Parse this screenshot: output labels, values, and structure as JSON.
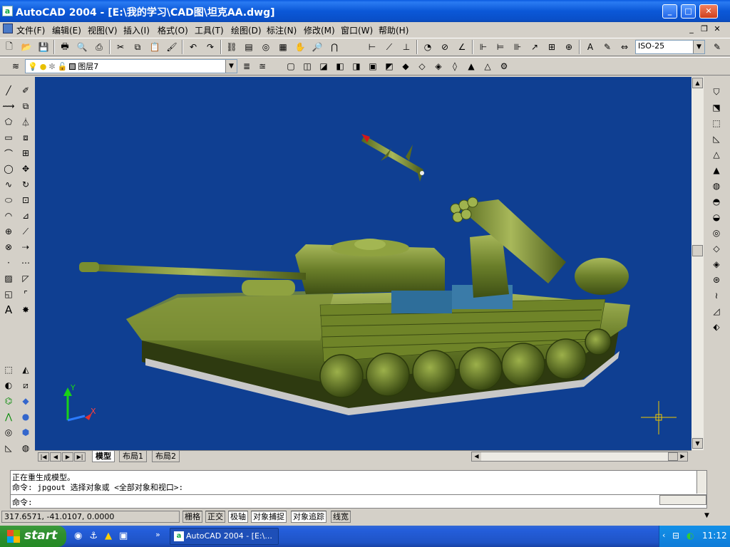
{
  "title_bar": {
    "app_icon_letter": "a",
    "title": "AutoCAD 2004 - [E:\\我的学习\\CAD图\\坦克AA.dwg]"
  },
  "menu": {
    "items": [
      "文件(F)",
      "编辑(E)",
      "视图(V)",
      "插入(I)",
      "格式(O)",
      "工具(T)",
      "绘图(D)",
      "标注(N)",
      "修改(M)",
      "窗口(W)",
      "帮助(H)"
    ]
  },
  "toolbar": {
    "dimstyle": "ISO-25",
    "layer": "图层7"
  },
  "layout_tabs": {
    "tabs": [
      "模型",
      "布局1",
      "布局2"
    ],
    "active": "模型"
  },
  "ucs": {
    "y": "Y",
    "x": "X"
  },
  "command": {
    "lines": [
      "正在重生成模型。",
      "命令: jpgout 选择对象或 <全部对象和视口>:"
    ],
    "prompt": "命令:"
  },
  "status": {
    "coords": "317.6571, -41.0107, 0.0000",
    "toggles": [
      "栅格",
      "正交",
      "极轴",
      "对象捕捉",
      "对象追踪",
      "线宽"
    ]
  },
  "taskbar": {
    "start": "start",
    "task": "AutoCAD 2004 - [E:\\...",
    "clock": "11:12"
  },
  "colors": {
    "viewport_bg": "#0f3f92",
    "tank_olive": "#6b7f2a",
    "titlebar": "#0a5ae0"
  }
}
